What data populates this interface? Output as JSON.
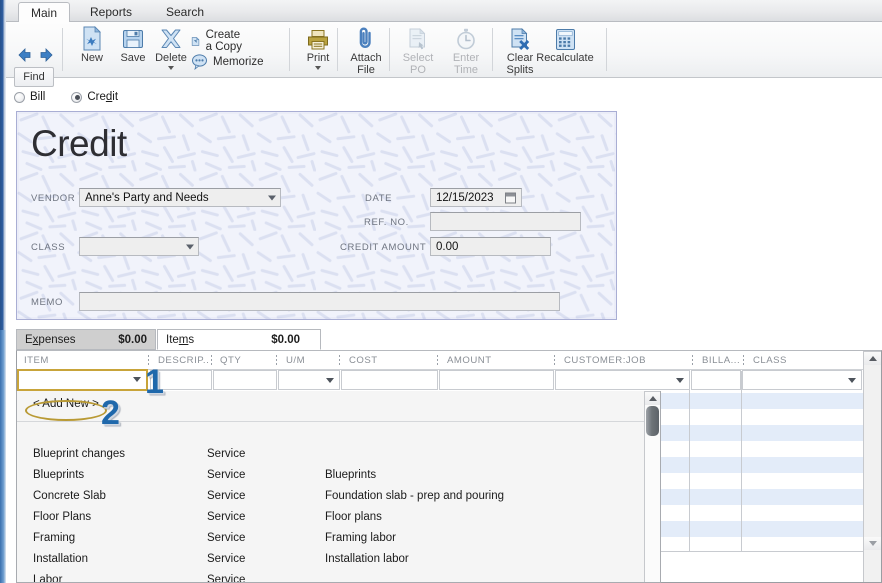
{
  "window": {
    "ribbon_tabs": [
      {
        "label": "Main",
        "active": true
      },
      {
        "label": "Reports",
        "active": false
      },
      {
        "label": "Search",
        "active": false
      }
    ]
  },
  "toolbar": {
    "find_label": "Find",
    "back_icon": "back-arrow-icon",
    "forward_icon": "forward-arrow-icon",
    "buttons": [
      {
        "label": "New",
        "icon": "new-document-icon",
        "disabled": false
      },
      {
        "label": "Save",
        "icon": "save-disk-icon",
        "disabled": false
      },
      {
        "label": "Delete",
        "icon": "delete-x-icon",
        "disabled": false,
        "has_dropdown": true
      },
      {
        "label": "Print",
        "icon": "printer-icon",
        "disabled": false,
        "has_dropdown": true
      },
      {
        "label": "Attach\nFile",
        "icon": "paperclip-icon",
        "disabled": false
      },
      {
        "label": "Select\nPO",
        "icon": "select-po-icon",
        "disabled": true
      },
      {
        "label": "Enter\nTime",
        "icon": "stopwatch-icon",
        "disabled": true
      },
      {
        "label": "Clear\nSplits",
        "icon": "clear-splits-icon",
        "disabled": false
      },
      {
        "label": "Recalculate",
        "icon": "calculator-icon",
        "disabled": false
      }
    ],
    "stacked": [
      {
        "label": "Create a Copy",
        "icon": "copy-icon"
      },
      {
        "label": "Memorize",
        "icon": "memorize-icon"
      }
    ]
  },
  "transaction_type": {
    "options": [
      {
        "label": "Bill",
        "selected": false,
        "accel": ""
      },
      {
        "label": "Credit",
        "selected": true,
        "accel": "d"
      }
    ]
  },
  "form": {
    "title": "Credit",
    "fields": {
      "vendor_label": "VENDOR",
      "vendor_value": "Anne's Party and Needs",
      "class_label": "CLASS",
      "class_value": "",
      "memo_label": "MEMO",
      "memo_value": "",
      "date_label": "DATE",
      "date_value": "12/15/2023",
      "ref_no_label": "REF. NO.",
      "ref_no_value": "",
      "credit_amount_label": "CREDIT AMOUNT",
      "credit_amount_value": "0.00"
    }
  },
  "sheet_tabs": [
    {
      "label": "Expenses",
      "amount": "$0.00",
      "active": false,
      "accel": "x"
    },
    {
      "label": "Items",
      "amount": "$0.00",
      "active": true,
      "accel": "m"
    }
  ],
  "grid": {
    "columns": [
      {
        "label": "ITEM"
      },
      {
        "label": "DESCRIP..."
      },
      {
        "label": "QTY"
      },
      {
        "label": "U/M"
      },
      {
        "label": "COST"
      },
      {
        "label": "AMOUNT"
      },
      {
        "label": "CUSTOMER:JOB"
      },
      {
        "label": "BILLA..."
      },
      {
        "label": "CLASS"
      }
    ],
    "row_values": [
      "",
      "",
      "",
      "",
      "",
      "",
      "",
      "",
      ""
    ]
  },
  "dropdown": {
    "add_new_label": "< Add New >",
    "items": [
      {
        "name": "Blueprint changes",
        "type": "Service",
        "description": ""
      },
      {
        "name": "Blueprints",
        "type": "Service",
        "description": "Blueprints"
      },
      {
        "name": "Concrete Slab",
        "type": "Service",
        "description": "Foundation slab - prep and pouring"
      },
      {
        "name": "Floor Plans",
        "type": "Service",
        "description": "Floor plans"
      },
      {
        "name": "Framing",
        "type": "Service",
        "description": "Framing labor"
      },
      {
        "name": "Installation",
        "type": "Service",
        "description": "Installation labor"
      },
      {
        "name": "Labor",
        "type": "Service",
        "description": ""
      }
    ]
  },
  "annotations": [
    {
      "number": "1",
      "target": "item-cell-dropdown"
    },
    {
      "number": "2",
      "target": "add-new-option"
    }
  ],
  "colors": {
    "annotation_blue": "#1f68ab",
    "annotation_gold": "#b99a35",
    "highlight_gold": "#c8a43a",
    "form_border": "#a9aed4",
    "form_bg": "#f2f4fb",
    "stripe_blue": "#e3ecf9"
  }
}
